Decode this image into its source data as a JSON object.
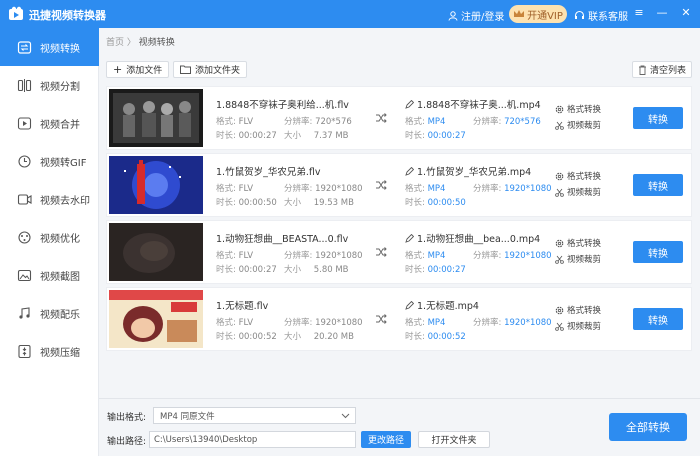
{
  "app": {
    "title": "迅捷视频转换器",
    "login": "注册/登录",
    "vip": "开通VIP",
    "service": "联系客服"
  },
  "sidebar": {
    "items": [
      {
        "label": "视频转换",
        "icon": "convert-icon"
      },
      {
        "label": "视频分割",
        "icon": "split-icon"
      },
      {
        "label": "视频合并",
        "icon": "merge-icon"
      },
      {
        "label": "视频转GIF",
        "icon": "gif-icon"
      },
      {
        "label": "视频去水印",
        "icon": "watermark-icon"
      },
      {
        "label": "视频优化",
        "icon": "optimize-icon"
      },
      {
        "label": "视频截图",
        "icon": "screenshot-icon"
      },
      {
        "label": "视频配乐",
        "icon": "music-icon"
      },
      {
        "label": "视频压缩",
        "icon": "compress-icon"
      }
    ]
  },
  "breadcrumb": {
    "home": "首页",
    "sep": "〉",
    "current": "视频转换"
  },
  "toolbar": {
    "add_file": "添加文件",
    "add_folder": "添加文件夹",
    "clear": "清空列表"
  },
  "labels": {
    "format": "格式:",
    "resolution": "分辨率:",
    "duration": "时长:",
    "size": "大小",
    "format_convert": "格式转换",
    "video_clip": "视频裁剪",
    "convert": "转换"
  },
  "files": [
    {
      "src_name": "1.8848不穿袜子奥利给...机.flv",
      "src_format": "FLV",
      "src_res": "720*576",
      "src_duration": "00:00:27",
      "src_size": "7.37 MB",
      "dst_name": "1.8848不穿袜子奥...机.mp4",
      "dst_format": "MP4",
      "dst_res": "720*576",
      "dst_duration": "00:00:27"
    },
    {
      "src_name": "1.竹鼠贺岁_华农兄弟.flv",
      "src_format": "FLV",
      "src_res": "1920*1080",
      "src_duration": "00:00:50",
      "src_size": "19.53 MB",
      "dst_name": "1.竹鼠贺岁_华农兄弟.mp4",
      "dst_format": "MP4",
      "dst_res": "1920*1080",
      "dst_duration": "00:00:50"
    },
    {
      "src_name": "1.动物狂想曲__BEASTA...0.flv",
      "src_format": "FLV",
      "src_res": "1920*1080",
      "src_duration": "00:00:27",
      "src_size": "5.80 MB",
      "dst_name": "1.动物狂想曲__bea...0.mp4",
      "dst_format": "MP4",
      "dst_res": "1920*1080",
      "dst_duration": "00:00:27"
    },
    {
      "src_name": "1.无标题.flv",
      "src_format": "FLV",
      "src_res": "1920*1080",
      "src_duration": "00:00:52",
      "src_size": "20.20 MB",
      "dst_name": "1.无标题.mp4",
      "dst_format": "MP4",
      "dst_res": "1920*1080",
      "dst_duration": "00:00:52"
    }
  ],
  "bottom": {
    "format_label": "输出格式:",
    "format_value": "MP4   同原文件",
    "path_label": "输出路径:",
    "path_value": "C:\\Users\\13940\\Desktop",
    "change_path": "更改路径",
    "open_folder": "打开文件夹",
    "convert_all": "全部转换"
  },
  "colors": {
    "accent": "#2d8cf0",
    "vip_bg": "#fde2b0"
  }
}
